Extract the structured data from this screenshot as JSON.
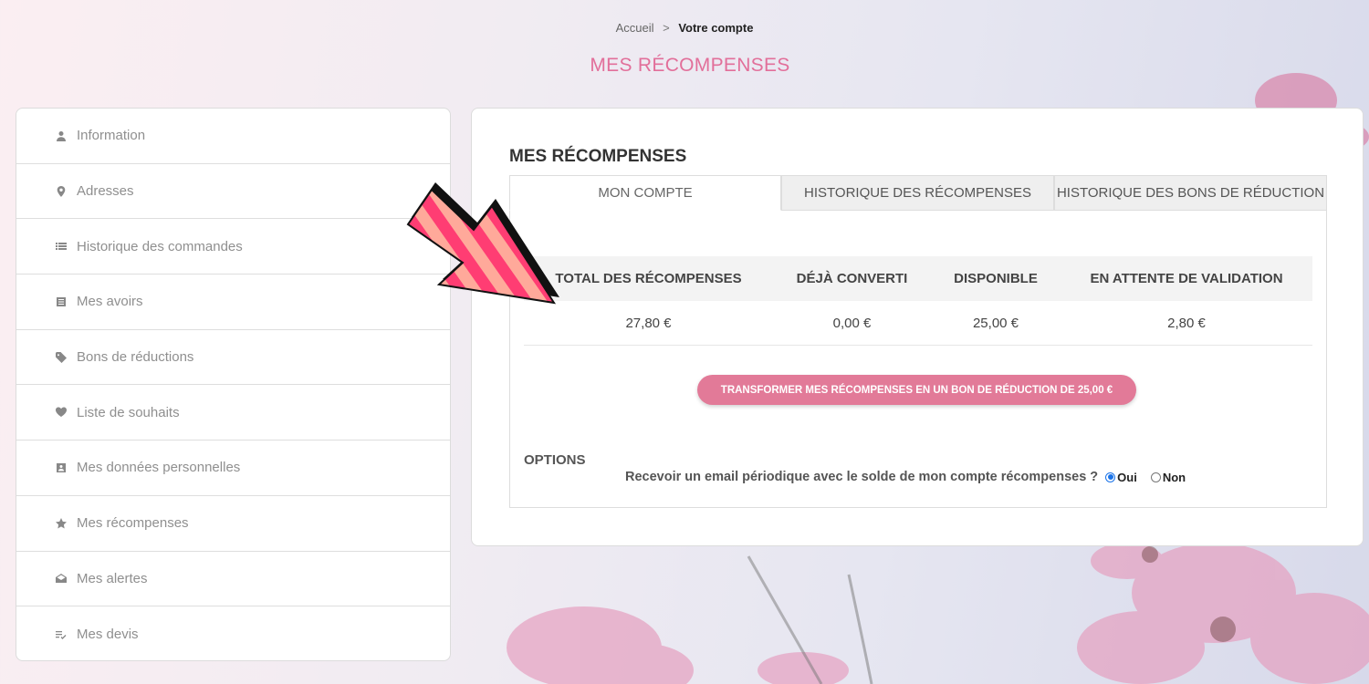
{
  "breadcrumb": {
    "home": "Accueil",
    "separator": ">",
    "current": "Votre compte"
  },
  "page_title": "MES RÉCOMPENSES",
  "sidebar": {
    "items": [
      {
        "label": "Information",
        "icon": "user-icon"
      },
      {
        "label": "Adresses",
        "icon": "map-pin-icon"
      },
      {
        "label": "Historique des commandes",
        "icon": "list-icon"
      },
      {
        "label": "Mes avoirs",
        "icon": "receipt-icon"
      },
      {
        "label": "Bons de réductions",
        "icon": "tag-icon"
      },
      {
        "label": "Liste de souhaits",
        "icon": "heart-icon"
      },
      {
        "label": "Mes données personnelles",
        "icon": "id-card-icon"
      },
      {
        "label": "Mes récompenses",
        "icon": "star-icon"
      },
      {
        "label": "Mes alertes",
        "icon": "envelope-open-icon"
      },
      {
        "label": "Mes devis",
        "icon": "checklist-icon"
      }
    ]
  },
  "panel": {
    "title": "MES RÉCOMPENSES",
    "tabs": [
      {
        "label": "MON COMPTE",
        "active": true
      },
      {
        "label": "HISTORIQUE DES RÉCOMPENSES",
        "active": false
      },
      {
        "label": "HISTORIQUE DES BONS DE RÉDUCTION",
        "active": false
      }
    ],
    "table": {
      "headers": [
        "TOTAL DES RÉCOMPENSES",
        "DÉJÀ CONVERTI",
        "DISPONIBLE",
        "EN ATTENTE DE VALIDATION"
      ],
      "values": [
        "27,80 €",
        "0,00 €",
        "25,00 €",
        "2,80 €"
      ]
    },
    "convert_button": "TRANSFORMER MES RÉCOMPENSES EN UN BON DE RÉDUCTION DE 25,00 €",
    "options_label": "OPTIONS",
    "email_question": "Recevoir un email périodique avec le solde de mon compte récompenses ?",
    "radio_yes": "Oui",
    "radio_no": "Non",
    "email_selected": "Oui"
  },
  "colors": {
    "accent_pink": "#e26f9a",
    "button_pink": "#e27a98",
    "arrow_pink": "#ff3d73",
    "arrow_peach": "#ffa99a"
  }
}
